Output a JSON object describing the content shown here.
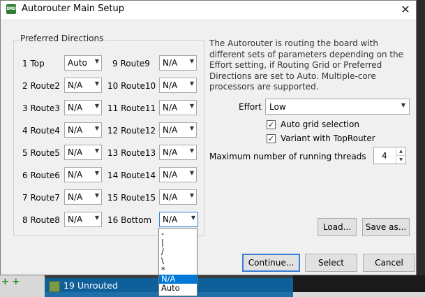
{
  "window": {
    "title": "Autorouter Main Setup",
    "close_glyph": "✕",
    "app_icon": "BRD"
  },
  "preferred_directions": {
    "group_label": "Preferred Directions",
    "left": [
      {
        "label": "1  Top",
        "value": "Auto"
      },
      {
        "label": "2  Route2",
        "value": "N/A"
      },
      {
        "label": "3  Route3",
        "value": "N/A"
      },
      {
        "label": "4  Route4",
        "value": "N/A"
      },
      {
        "label": "5  Route5",
        "value": "N/A"
      },
      {
        "label": "6  Route6",
        "value": "N/A"
      },
      {
        "label": "7  Route7",
        "value": "N/A"
      },
      {
        "label": "8  Route8",
        "value": "N/A"
      }
    ],
    "right": [
      {
        "label": "9  Route9",
        "value": "N/A"
      },
      {
        "label": "10  Route10",
        "value": "N/A"
      },
      {
        "label": "11  Route11",
        "value": "N/A"
      },
      {
        "label": "12  Route12",
        "value": "N/A"
      },
      {
        "label": "13  Route13",
        "value": "N/A"
      },
      {
        "label": "14  Route14",
        "value": "N/A"
      },
      {
        "label": "15  Route15",
        "value": "N/A"
      },
      {
        "label": "16  Bottom",
        "value": "N/A"
      }
    ],
    "dropdown_options": [
      "-",
      "|",
      "/",
      "\\",
      "*",
      "N/A",
      "Auto"
    ],
    "dropdown_selected": "N/A"
  },
  "description": "The Autorouter is routing the board with different sets of parameters depending on the Effort setting, if Routing Grid or Preferred Directions are set to Auto. Multiple-core processors are supported.",
  "effort": {
    "label": "Effort",
    "value": "Low"
  },
  "options": {
    "auto_grid": {
      "label": "Auto grid selection",
      "checked": true
    },
    "variant_toprouter": {
      "label": "Variant with TopRouter",
      "checked": true
    }
  },
  "threads": {
    "label": "Maximum number of running threads",
    "value": "4"
  },
  "buttons": {
    "load": "Load...",
    "save_as": "Save as...",
    "continue": "Continue...",
    "select": "Select",
    "cancel": "Cancel"
  },
  "background": {
    "row_label": "19 Unrouted",
    "tool_icons": "+ +"
  },
  "colors": {
    "accent": "#0078d7",
    "focus_border": "#3a7fd5",
    "background_row": "#0f5f9a"
  },
  "icons": {
    "checkbox": "check-icon",
    "combo_arrow": "chevron-down-icon",
    "spin_up": "up-arrow-icon",
    "spin_down": "down-arrow-icon"
  }
}
